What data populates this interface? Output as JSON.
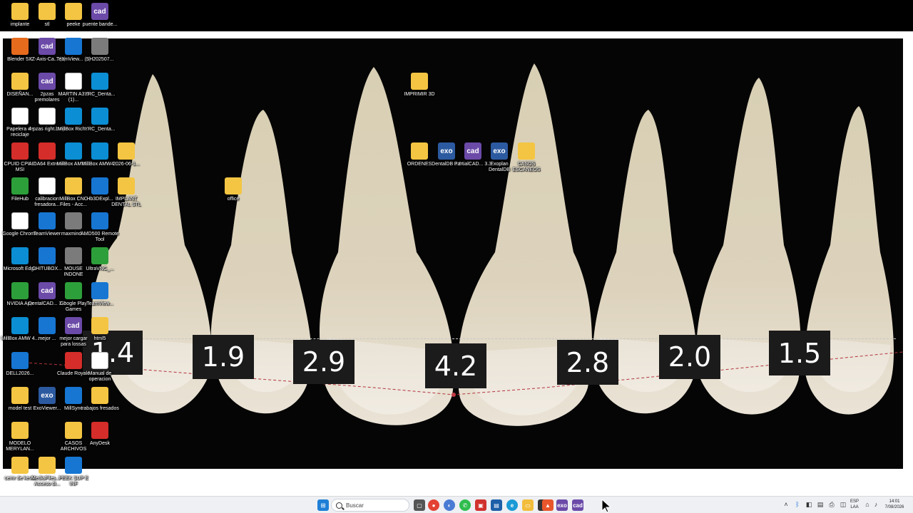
{
  "photo": {
    "measurements": [
      "1.4",
      "1.9",
      "2.9",
      "4.2",
      "2.8",
      "2.0",
      "1.5"
    ]
  },
  "desktop_icons": [
    {
      "id": "implante",
      "label": "implante",
      "icon": "folder-icon",
      "kind": "folder"
    },
    {
      "id": "stl",
      "label": "stl",
      "icon": "folder-icon",
      "kind": "folder"
    },
    {
      "id": "peeke",
      "label": "peeke",
      "icon": "folder-icon",
      "kind": "folder"
    },
    {
      "id": "puente",
      "label": "puente bande...",
      "icon": "exocad-icon",
      "kind": "cad"
    },
    {
      "id": "blender",
      "label": "Blender 5.1",
      "icon": "blender-icon",
      "kind": "orange"
    },
    {
      "id": "xzaxis",
      "label": "XZ-Axis-Ca... (2)",
      "icon": "exocad-icon",
      "kind": "cad"
    },
    {
      "id": "teamviewer3",
      "label": "TeamView... (3)",
      "icon": "teamviewer-icon",
      "kind": "blue"
    },
    {
      "id": "sh2025",
      "label": "SH202507...",
      "icon": "app-icon",
      "kind": "gray"
    },
    {
      "id": "diseno",
      "label": "DISEÑAN...",
      "icon": "folder-icon",
      "kind": "folder"
    },
    {
      "id": "2pzas",
      "label": "2pzas premolares",
      "icon": "exocad-icon",
      "kind": "cad"
    },
    {
      "id": "martin",
      "label": "MARTIN A3.3 (1)...",
      "icon": "file-icon",
      "kind": "file"
    },
    {
      "id": "yrc1",
      "label": "YRC_Denta...",
      "icon": "yrc-icon",
      "kind": "teal"
    },
    {
      "id": "papelera",
      "label": "Papelera de reciclaje",
      "icon": "recycle-bin-icon",
      "kind": "file"
    },
    {
      "id": "4pzas",
      "label": "4 pzas right.bmp",
      "icon": "file-icon",
      "kind": "file"
    },
    {
      "id": "millbox1",
      "label": "MillBox Rich...",
      "icon": "millbox-icon",
      "kind": "teal"
    },
    {
      "id": "yrc2",
      "label": "YRC_Denta...",
      "icon": "yrc-icon",
      "kind": "teal"
    },
    {
      "id": "cpuid",
      "label": "CPUID CPU-Z MSI",
      "icon": "cpuz-icon",
      "kind": "red"
    },
    {
      "id": "aida64",
      "label": "AIDA64 Extreme",
      "icon": "aida64-icon",
      "kind": "red"
    },
    {
      "id": "millbox2",
      "label": "MillBox AMW...",
      "icon": "millbox-icon",
      "kind": "teal"
    },
    {
      "id": "millbox3",
      "label": "MillBox AMW4...",
      "icon": "millbox-icon",
      "kind": "teal"
    },
    {
      "id": "2026",
      "label": "2026-06-1...",
      "icon": "folder-icon",
      "kind": "folder"
    },
    {
      "id": "filehub",
      "label": "FileHub",
      "icon": "filehub-icon",
      "kind": "green"
    },
    {
      "id": "calibracion",
      "label": "calibracion fresadora...",
      "icon": "file-icon",
      "kind": "file"
    },
    {
      "id": "millboxcnc",
      "label": "MillBox CNC Files - Acc...",
      "icon": "folder-icon",
      "kind": "folder"
    },
    {
      "id": "hb3d",
      "label": "Hb3DExpl...",
      "icon": "hb3d-icon",
      "kind": "blue"
    },
    {
      "id": "implant",
      "label": "IMPLANT DENTAL STL",
      "icon": "folder-icon",
      "kind": "folder"
    },
    {
      "id": "chrome",
      "label": "Google Chrome",
      "icon": "file-icon",
      "kind": "file"
    },
    {
      "id": "teamviewer",
      "label": "TeamViewer",
      "icon": "teamviewer-icon",
      "kind": "blue"
    },
    {
      "id": "maxmind",
      "label": "maxmind...",
      "icon": "app-icon",
      "kind": "gray"
    },
    {
      "id": "amd",
      "label": "AMD500 Remote Tool",
      "icon": "vscode-icon",
      "kind": "blue"
    },
    {
      "id": "edge",
      "label": "Microsoft Edge",
      "icon": "edge-icon",
      "kind": "teal"
    },
    {
      "id": "chitubox",
      "label": "CHITUBOX...",
      "icon": "chitubox-icon",
      "kind": "blue"
    },
    {
      "id": "mouse",
      "label": "MOUSE INDONE",
      "icon": "mouse-icon",
      "kind": "gray"
    },
    {
      "id": "ultravnc",
      "label": "UltraVNC_...",
      "icon": "ultravnc-icon",
      "kind": "green"
    },
    {
      "id": "nvidia",
      "label": "NVIDIA App",
      "icon": "nvidia-icon",
      "kind": "green"
    },
    {
      "id": "dentalcad",
      "label": "DentalCAD... 3.2",
      "icon": "exocad-icon",
      "kind": "cad"
    },
    {
      "id": "playgames",
      "label": "Google Play Games",
      "icon": "play-icon",
      "kind": "green"
    },
    {
      "id": "teamview2",
      "label": "TeamView...",
      "icon": "teamviewer-icon",
      "kind": "blue"
    },
    {
      "id": "millbox4",
      "label": "MillBox AMW 4...",
      "icon": "millbox-icon",
      "kind": "teal"
    },
    {
      "id": "mejor",
      "label": "mejor ...",
      "icon": "app-icon",
      "kind": "blue"
    },
    {
      "id": "mejor2",
      "label": "mejor cargar para lossas",
      "icon": "exocad-icon",
      "kind": "cad"
    },
    {
      "id": "html",
      "label": "html5",
      "icon": "folder-icon",
      "kind": "folder"
    },
    {
      "id": "dell",
      "label": "DELL2026...",
      "icon": "dell-icon",
      "kind": "blue"
    },
    {
      "id": "claude",
      "label": "Claude Royale",
      "icon": "game-icon",
      "kind": "red"
    },
    {
      "id": "manual",
      "label": "Manual de operacion",
      "icon": "file-icon",
      "kind": "file"
    },
    {
      "id": "modeltest",
      "label": "model test",
      "icon": "folder-icon",
      "kind": "folder"
    },
    {
      "id": "exoviewer",
      "label": "ExoViewer...",
      "icon": "exoviewer-icon",
      "kind": "exo"
    },
    {
      "id": "millsync",
      "label": "MillSync",
      "icon": "millsync-icon",
      "kind": "blue"
    },
    {
      "id": "trabajos",
      "label": "trabajos fresados",
      "icon": "folder-icon",
      "kind": "folder"
    },
    {
      "id": "modelo",
      "label": "MODELO MERYLAN...",
      "icon": "folder-icon",
      "kind": "folder"
    },
    {
      "id": "casos1",
      "label": "CASOS ARCHIVOS",
      "icon": "folder-icon",
      "kind": "folder"
    },
    {
      "id": "anydesk",
      "label": "AnyDesk",
      "icon": "anydesk-icon",
      "kind": "red"
    },
    {
      "id": "cemr",
      "label": "cemr de kevin",
      "icon": "folder-icon",
      "kind": "folder"
    },
    {
      "id": "mediafiles",
      "label": "MediaFiles... - Acceso di...",
      "icon": "folder-icon",
      "kind": "folder"
    },
    {
      "id": "peek",
      "label": "PEEK SUP E INF",
      "icon": "dell-icon",
      "kind": "blue"
    },
    {
      "id": "office",
      "label": "office",
      "icon": "folder-icon",
      "kind": "folder"
    },
    {
      "id": "imprimir",
      "label": "IMPRIMIR 3D",
      "icon": "folder-icon",
      "kind": "folder"
    },
    {
      "id": "ordenes",
      "label": "ORDENES",
      "icon": "folder-icon",
      "kind": "folder"
    },
    {
      "id": "dentaldb",
      "label": "DentalDB 3.2",
      "icon": "exocad-icon",
      "kind": "exo"
    },
    {
      "id": "partialcad",
      "label": "PartialCAD... 3.3",
      "icon": "partialcad-icon",
      "kind": "cad"
    },
    {
      "id": "exoplan",
      "label": "Exoplan DentalDB",
      "icon": "exocad-icon",
      "kind": "exo"
    },
    {
      "id": "casos2",
      "label": "CASOS ESCANEOS",
      "icon": "folder-icon",
      "kind": "folder"
    }
  ],
  "taskbar": {
    "search_placeholder": "Buscar",
    "language": "ESP",
    "language_sub": "LAA",
    "time": "14:01",
    "date": "7/08/2026"
  }
}
